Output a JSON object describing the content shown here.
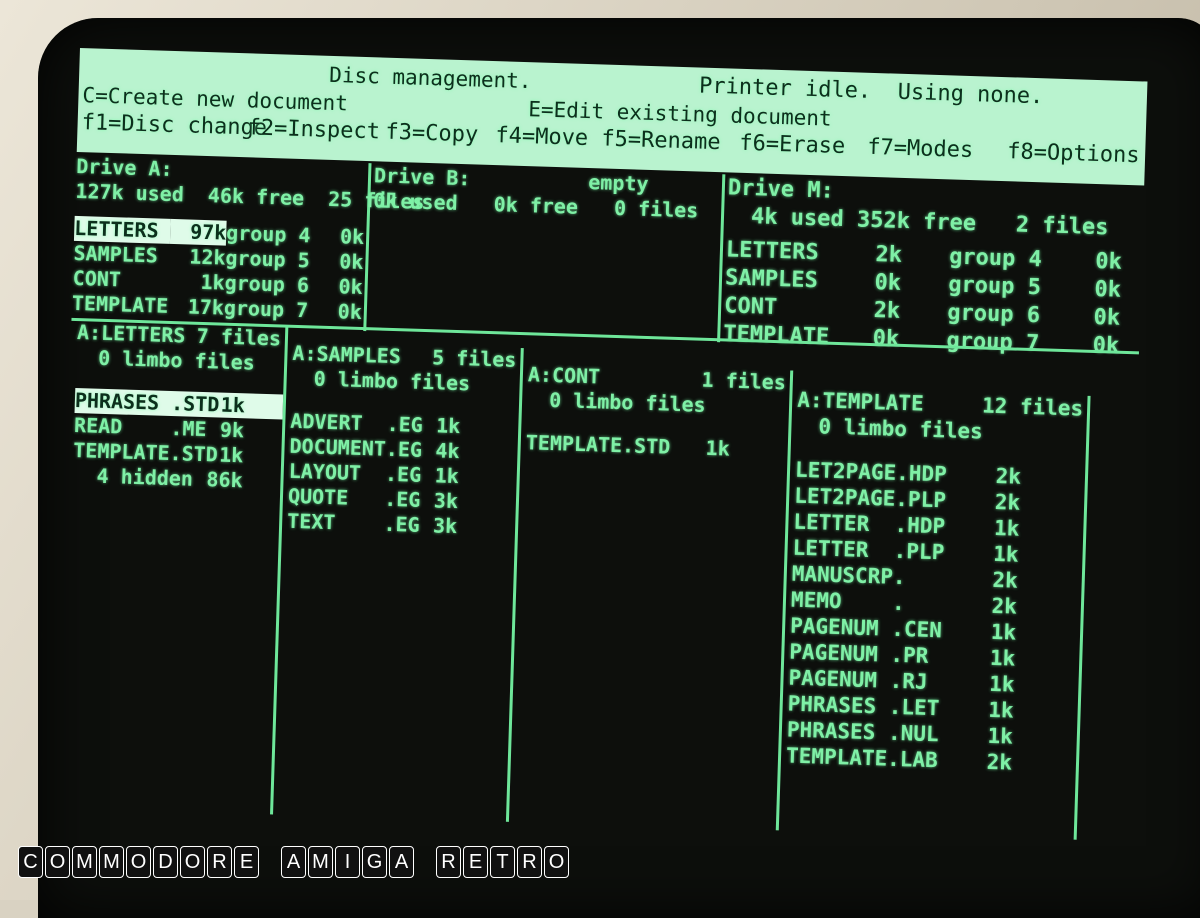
{
  "menubar": {
    "title": "Disc management.",
    "printer_status": "Printer idle.  Using none.",
    "create_hint": "C=Create new document",
    "edit_hint": "E=Edit existing document",
    "function_keys": [
      {
        "key": "f1",
        "label": "f1=Disc change"
      },
      {
        "key": "f2",
        "label": "f2=Inspect"
      },
      {
        "key": "f3",
        "label": "f3=Copy"
      },
      {
        "key": "f4",
        "label": "f4=Move"
      },
      {
        "key": "f5",
        "label": "f5=Rename"
      },
      {
        "key": "f6",
        "label": "f6=Erase"
      },
      {
        "key": "f7",
        "label": "f7=Modes"
      },
      {
        "key": "f8",
        "label": "f8=Options"
      }
    ]
  },
  "drives": {
    "a": {
      "title": "Drive A:",
      "stats": "127k used  46k free  25 files",
      "groups": [
        {
          "name": "LETTERS",
          "size": "97k",
          "group": "group 4",
          "extra": "0k",
          "selected": true
        },
        {
          "name": "SAMPLES",
          "size": "12k",
          "group": "group 5",
          "extra": "0k"
        },
        {
          "name": "CONT",
          "size": "1k",
          "group": "group 6",
          "extra": "0k"
        },
        {
          "name": "TEMPLATE",
          "size": "17k",
          "group": "group 7",
          "extra": "0k"
        }
      ]
    },
    "b": {
      "title": "Drive B:",
      "status": "empty",
      "stats": "0k used   0k free   0 files"
    },
    "m": {
      "title": "Drive M:",
      "stats": "4k used 352k free   2 files",
      "groups": [
        {
          "name": "LETTERS",
          "size": "2k",
          "group": "group 4",
          "extra": "0k"
        },
        {
          "name": "SAMPLES",
          "size": "0k",
          "group": "group 5",
          "extra": "0k"
        },
        {
          "name": "CONT",
          "size": "2k",
          "group": "group 6",
          "extra": "0k"
        },
        {
          "name": "TEMPLATE",
          "size": "0k",
          "group": "group 7",
          "extra": "0k"
        }
      ]
    }
  },
  "folders": [
    {
      "title": "A:LETTERS",
      "count": "7 files",
      "limbo": "0 limbo files",
      "files": [
        {
          "name": "PHRASES .STD",
          "size": "1k",
          "selected": true
        },
        {
          "name": "READ    .ME",
          "size": "9k"
        },
        {
          "name": "TEMPLATE.STD",
          "size": "1k"
        },
        {
          "name": "  4 hidden",
          "size": "86k"
        }
      ]
    },
    {
      "title": "A:SAMPLES",
      "count": "5 files",
      "limbo": "0 limbo files",
      "files": [
        {
          "name": "ADVERT  .EG",
          "size": "1k"
        },
        {
          "name": "DOCUMENT.EG",
          "size": "4k"
        },
        {
          "name": "LAYOUT  .EG",
          "size": "1k"
        },
        {
          "name": "QUOTE   .EG",
          "size": "3k"
        },
        {
          "name": "TEXT    .EG",
          "size": "3k"
        }
      ]
    },
    {
      "title": "A:CONT",
      "count": "1 files",
      "limbo": "0 limbo files",
      "files": [
        {
          "name": "TEMPLATE.STD",
          "size": "1k"
        }
      ]
    },
    {
      "title": "A:TEMPLATE",
      "count": "12 files",
      "limbo": "0 limbo files",
      "files": [
        {
          "name": "LET2PAGE.HDP",
          "size": "2k"
        },
        {
          "name": "LET2PAGE.PLP",
          "size": "2k"
        },
        {
          "name": "LETTER  .HDP",
          "size": "1k"
        },
        {
          "name": "LETTER  .PLP",
          "size": "1k"
        },
        {
          "name": "MANUSCRP.",
          "size": "2k"
        },
        {
          "name": "MEMO    .",
          "size": "2k"
        },
        {
          "name": "PAGENUM .CEN",
          "size": "1k"
        },
        {
          "name": "PAGENUM .PR",
          "size": "1k"
        },
        {
          "name": "PAGENUM .RJ",
          "size": "1k"
        },
        {
          "name": "PHRASES .LET",
          "size": "1k"
        },
        {
          "name": "PHRASES .NUL",
          "size": "1k"
        },
        {
          "name": "TEMPLATE.LAB",
          "size": "2k"
        }
      ]
    }
  ],
  "branding": {
    "words": [
      "COMMODORE",
      "AMIGA",
      "RETRO"
    ]
  }
}
